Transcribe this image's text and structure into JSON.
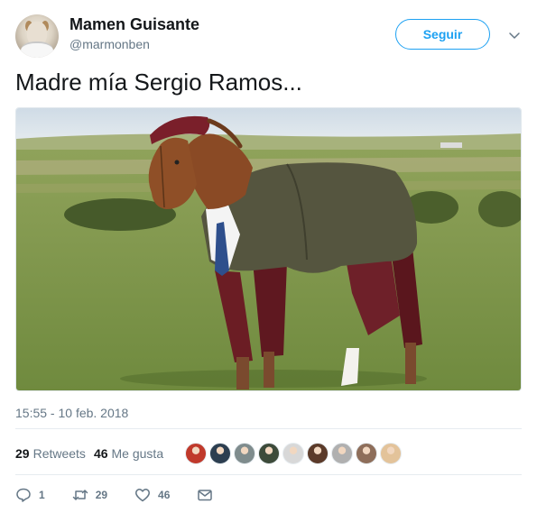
{
  "user": {
    "display_name": "Mamen Guisante",
    "screen_name": "@marmonben"
  },
  "follow_button_label": "Seguir",
  "tweet": {
    "text": "Madre mía Sergio Ramos...",
    "timestamp": "15:55 - 10 feb. 2018"
  },
  "stats": {
    "retweets_count": "29",
    "retweets_label": "Retweets",
    "likes_count": "46",
    "likes_label": "Me gusta"
  },
  "actions": {
    "reply_count": "1",
    "retweet_count": "29",
    "like_count": "46"
  },
  "likers": [
    {
      "color": "#c0392b"
    },
    {
      "color": "#2c3e50"
    },
    {
      "color": "#7f8c8d"
    },
    {
      "color": "#3d4b3a"
    },
    {
      "color": "#d8d8d8"
    },
    {
      "color": "#5b3a29"
    },
    {
      "color": "#b0b0b0"
    },
    {
      "color": "#8e6e5a"
    },
    {
      "color": "#e3c39a"
    }
  ],
  "colors": {
    "accent": "#1da1f2",
    "secondary_text": "#657786",
    "primary_text": "#14171a"
  },
  "icons": [
    "chevron-down-icon",
    "reply-icon",
    "retweet-icon",
    "heart-icon",
    "envelope-icon"
  ]
}
